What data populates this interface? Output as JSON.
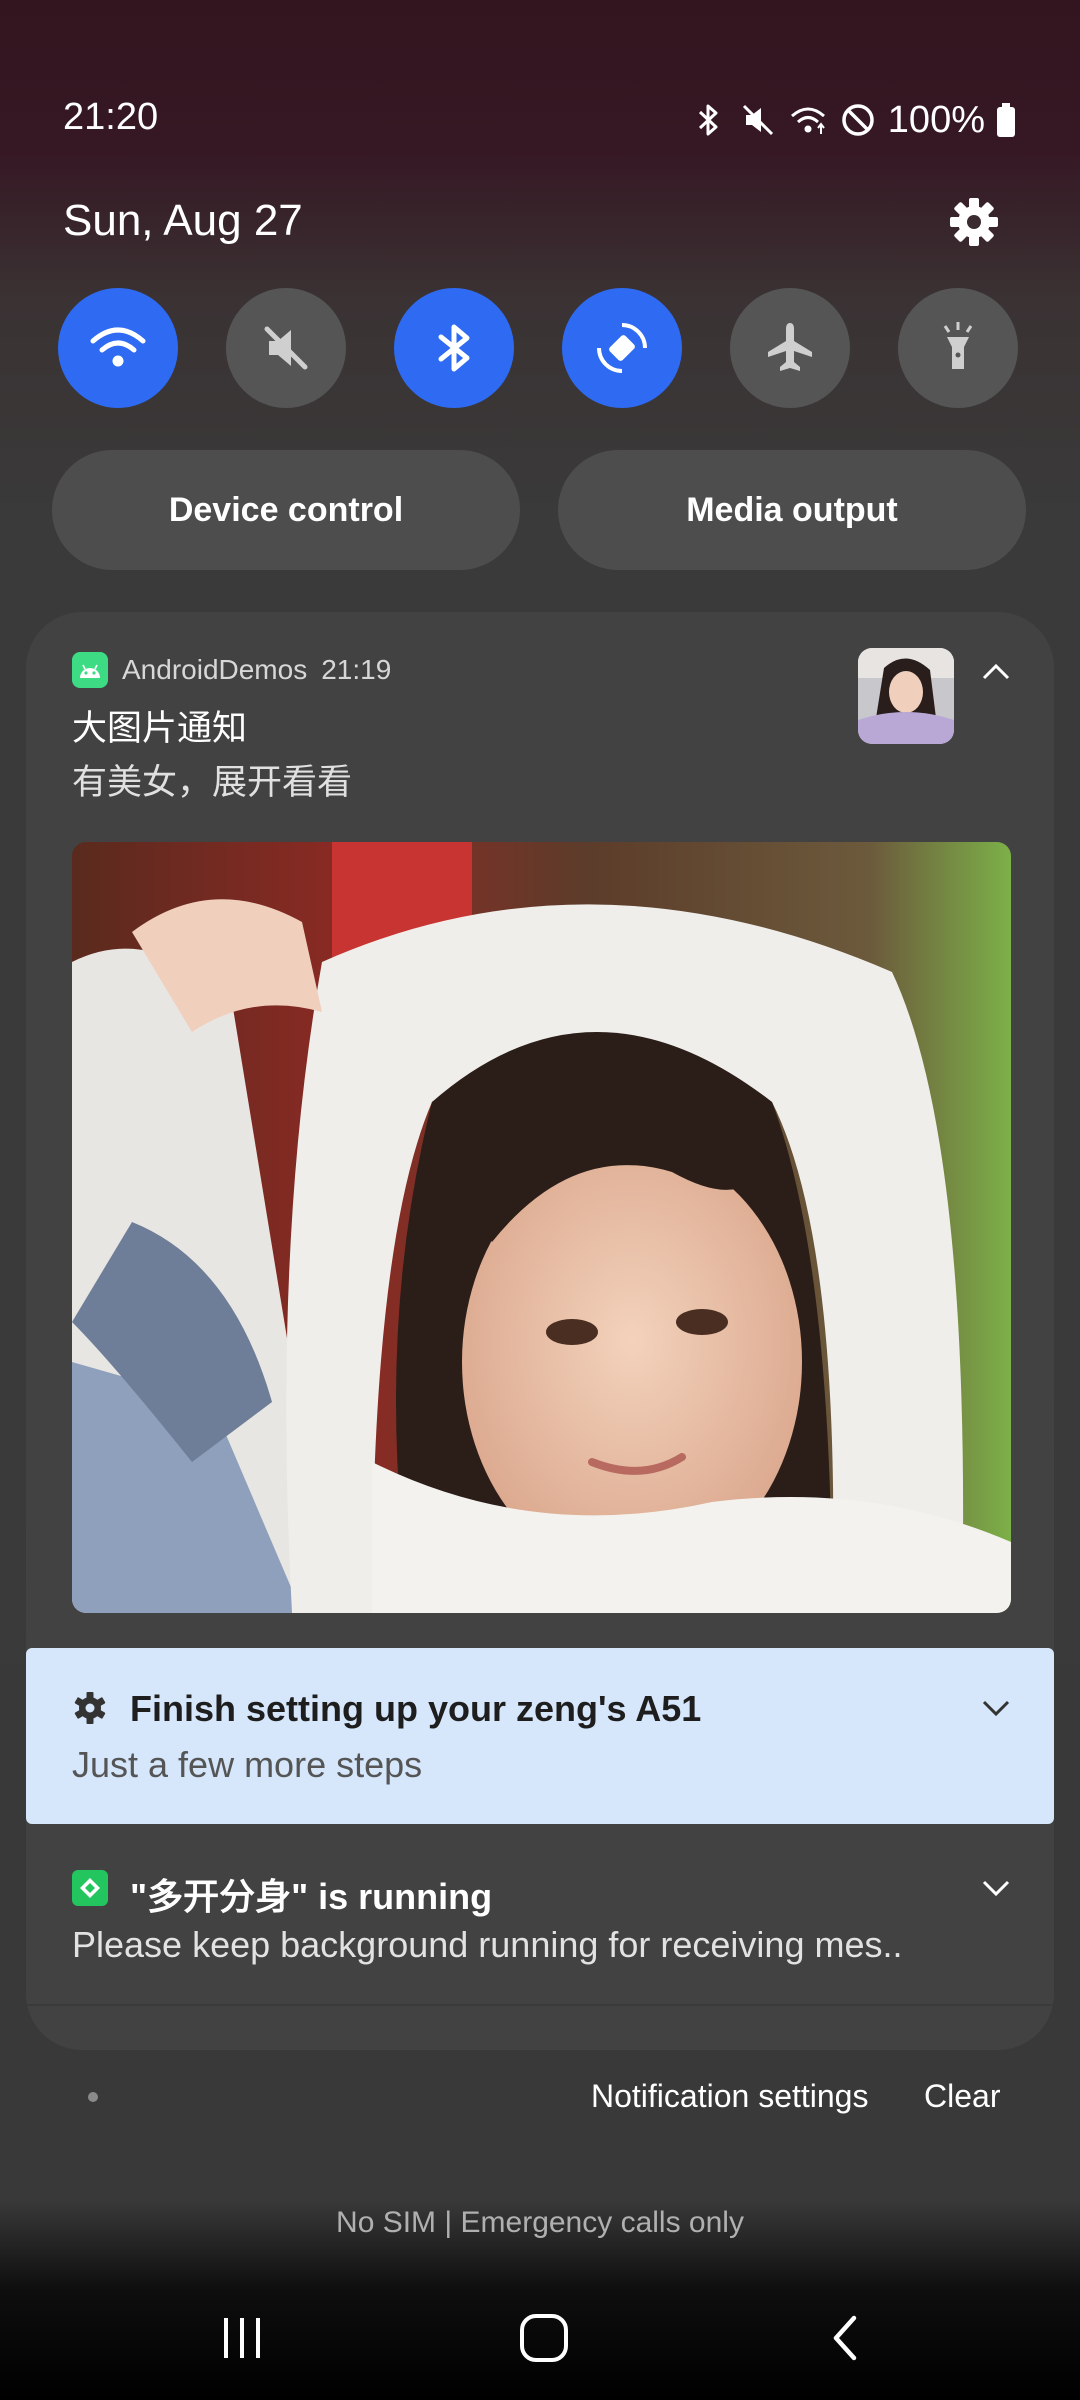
{
  "status_bar": {
    "time": "21:20",
    "battery": "100%",
    "icons": [
      "bluetooth-icon",
      "mute-icon",
      "wifi-icon",
      "do-not-disturb-icon",
      "battery-icon"
    ]
  },
  "header": {
    "date": "Sun, Aug 27"
  },
  "quick_toggles": [
    {
      "name": "wifi",
      "icon": "wifi-icon",
      "state": "on"
    },
    {
      "name": "mute",
      "icon": "mute-icon",
      "state": "off"
    },
    {
      "name": "bluetooth",
      "icon": "bluetooth-icon",
      "state": "on"
    },
    {
      "name": "auto-rotate",
      "icon": "auto-rotate-icon",
      "state": "on"
    },
    {
      "name": "airplane-mode",
      "icon": "airplane-icon",
      "state": "off"
    },
    {
      "name": "flashlight",
      "icon": "flashlight-icon",
      "state": "off"
    }
  ],
  "buttons": {
    "device_control": "Device control",
    "media_output": "Media output"
  },
  "notifications": [
    {
      "app": "AndroidDemos",
      "time": "21:19",
      "title": "大图片通知",
      "text": "有美女，展开看看",
      "expanded": true
    },
    {
      "title": "Finish setting up your zeng's A51",
      "text": "Just a few more steps"
    },
    {
      "title": "\"多开分身\" is running",
      "text": "Please keep background running for receiving mes.."
    }
  ],
  "footer": {
    "notification_settings": "Notification settings",
    "clear": "Clear",
    "carrier": "No SIM | Emergency calls only"
  },
  "colors": {
    "accent": "#2e6bf2",
    "toggle_off": "#555555",
    "highlight_notification": "#d6e6fb"
  }
}
